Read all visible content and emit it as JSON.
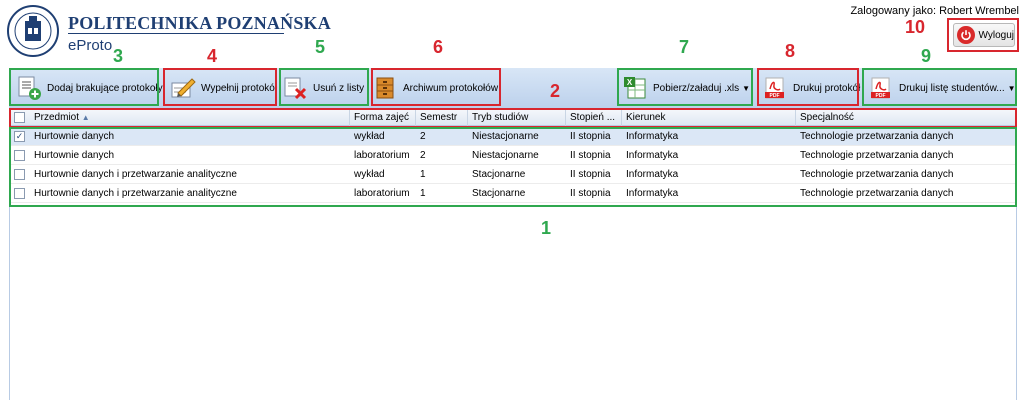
{
  "header": {
    "brand_title": "POLITECHNIKA POZNAŃSKA",
    "brand_sub": "eProto",
    "logged_in": "Zalogowany jako: Robert Wrembel",
    "logout_label": "Wyloguj"
  },
  "toolbar": {
    "add_missing": "Dodaj brakujące protokoły",
    "fill_protocol": "Wypełnij protokół",
    "remove": "Usuń z listy",
    "archive": "Archiwum protokołów",
    "xls": "Pobierz/załaduj .xls",
    "print_protocol": "Drukuj protokół",
    "print_students": "Drukuj listę studentów..."
  },
  "annotations": [
    "1",
    "2",
    "3",
    "4",
    "5",
    "6",
    "7",
    "8",
    "9",
    "10"
  ],
  "grid": {
    "columns": [
      "Przedmiot",
      "Forma zajęć",
      "Semestr",
      "Tryb studiów",
      "Stopień ...",
      "Kierunek",
      "Specjalność"
    ],
    "sort_indicator": "▲",
    "rows": [
      {
        "checked": true,
        "przedmiot": "Hurtownie danych",
        "forma": "wykład",
        "semestr": "2",
        "tryb": "Niestacjonarne",
        "stopien": "II stopnia",
        "kierunek": "Informatyka",
        "specjalnosc": "Technologie przetwarzania danych"
      },
      {
        "checked": false,
        "przedmiot": "Hurtownie danych",
        "forma": "laboratorium",
        "semestr": "2",
        "tryb": "Niestacjonarne",
        "stopien": "II stopnia",
        "kierunek": "Informatyka",
        "specjalnosc": "Technologie przetwarzania danych"
      },
      {
        "checked": false,
        "przedmiot": "Hurtownie danych i przetwarzanie analityczne",
        "forma": "wykład",
        "semestr": "1",
        "tryb": "Stacjonarne",
        "stopien": "II stopnia",
        "kierunek": "Informatyka",
        "specjalnosc": "Technologie przetwarzania danych"
      },
      {
        "checked": false,
        "przedmiot": "Hurtownie danych i przetwarzanie analityczne",
        "forma": "laboratorium",
        "semestr": "1",
        "tryb": "Stacjonarne",
        "stopien": "II stopnia",
        "kierunek": "Informatyka",
        "specjalnosc": "Technologie przetwarzania danych"
      }
    ]
  },
  "colors": {
    "annotation_green": "#2fa84f",
    "annotation_red": "#d8262e",
    "brand": "#1f3f73",
    "toolbar": "#c9dbf0"
  },
  "icons": [
    "university-logo-icon",
    "power-icon",
    "document-add-icon",
    "pencil-icon",
    "delete-icon",
    "archive-cabinet-icon",
    "excel-icon",
    "pdf-icon"
  ]
}
